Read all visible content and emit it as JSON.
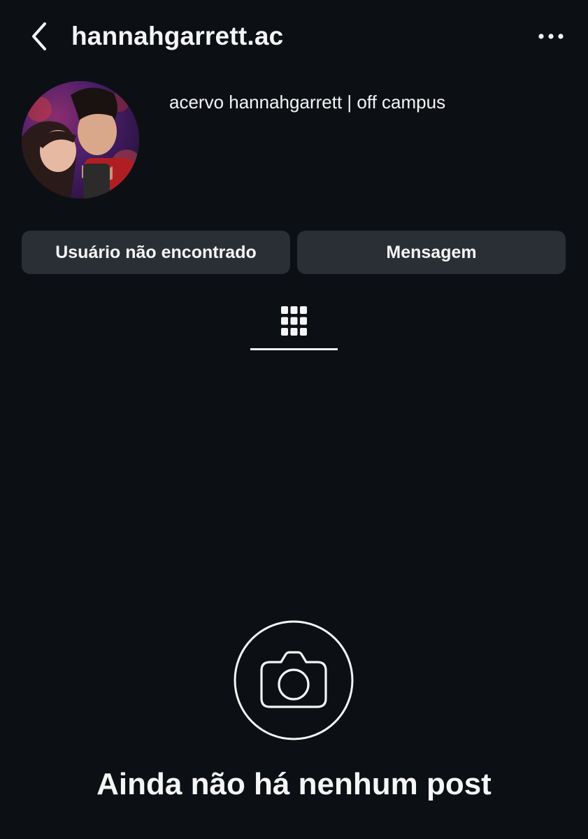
{
  "header": {
    "username": "hannahgarrett.ac",
    "back_icon": "chevron-left-icon",
    "more_icon": "more-horizontal-icon"
  },
  "profile": {
    "display_name": "acervo hannahgarrett | off campus",
    "avatar": "profile-photo"
  },
  "actions": {
    "status_label": "Usuário não encontrado",
    "message_label": "Mensagem"
  },
  "tabs": {
    "active": "grid-icon"
  },
  "empty_state": {
    "icon": "camera-icon",
    "title": "Ainda não há nenhum post"
  },
  "colors": {
    "background": "#0c1014",
    "button_bg": "#2a2f35",
    "text": "#f5f5f5"
  }
}
